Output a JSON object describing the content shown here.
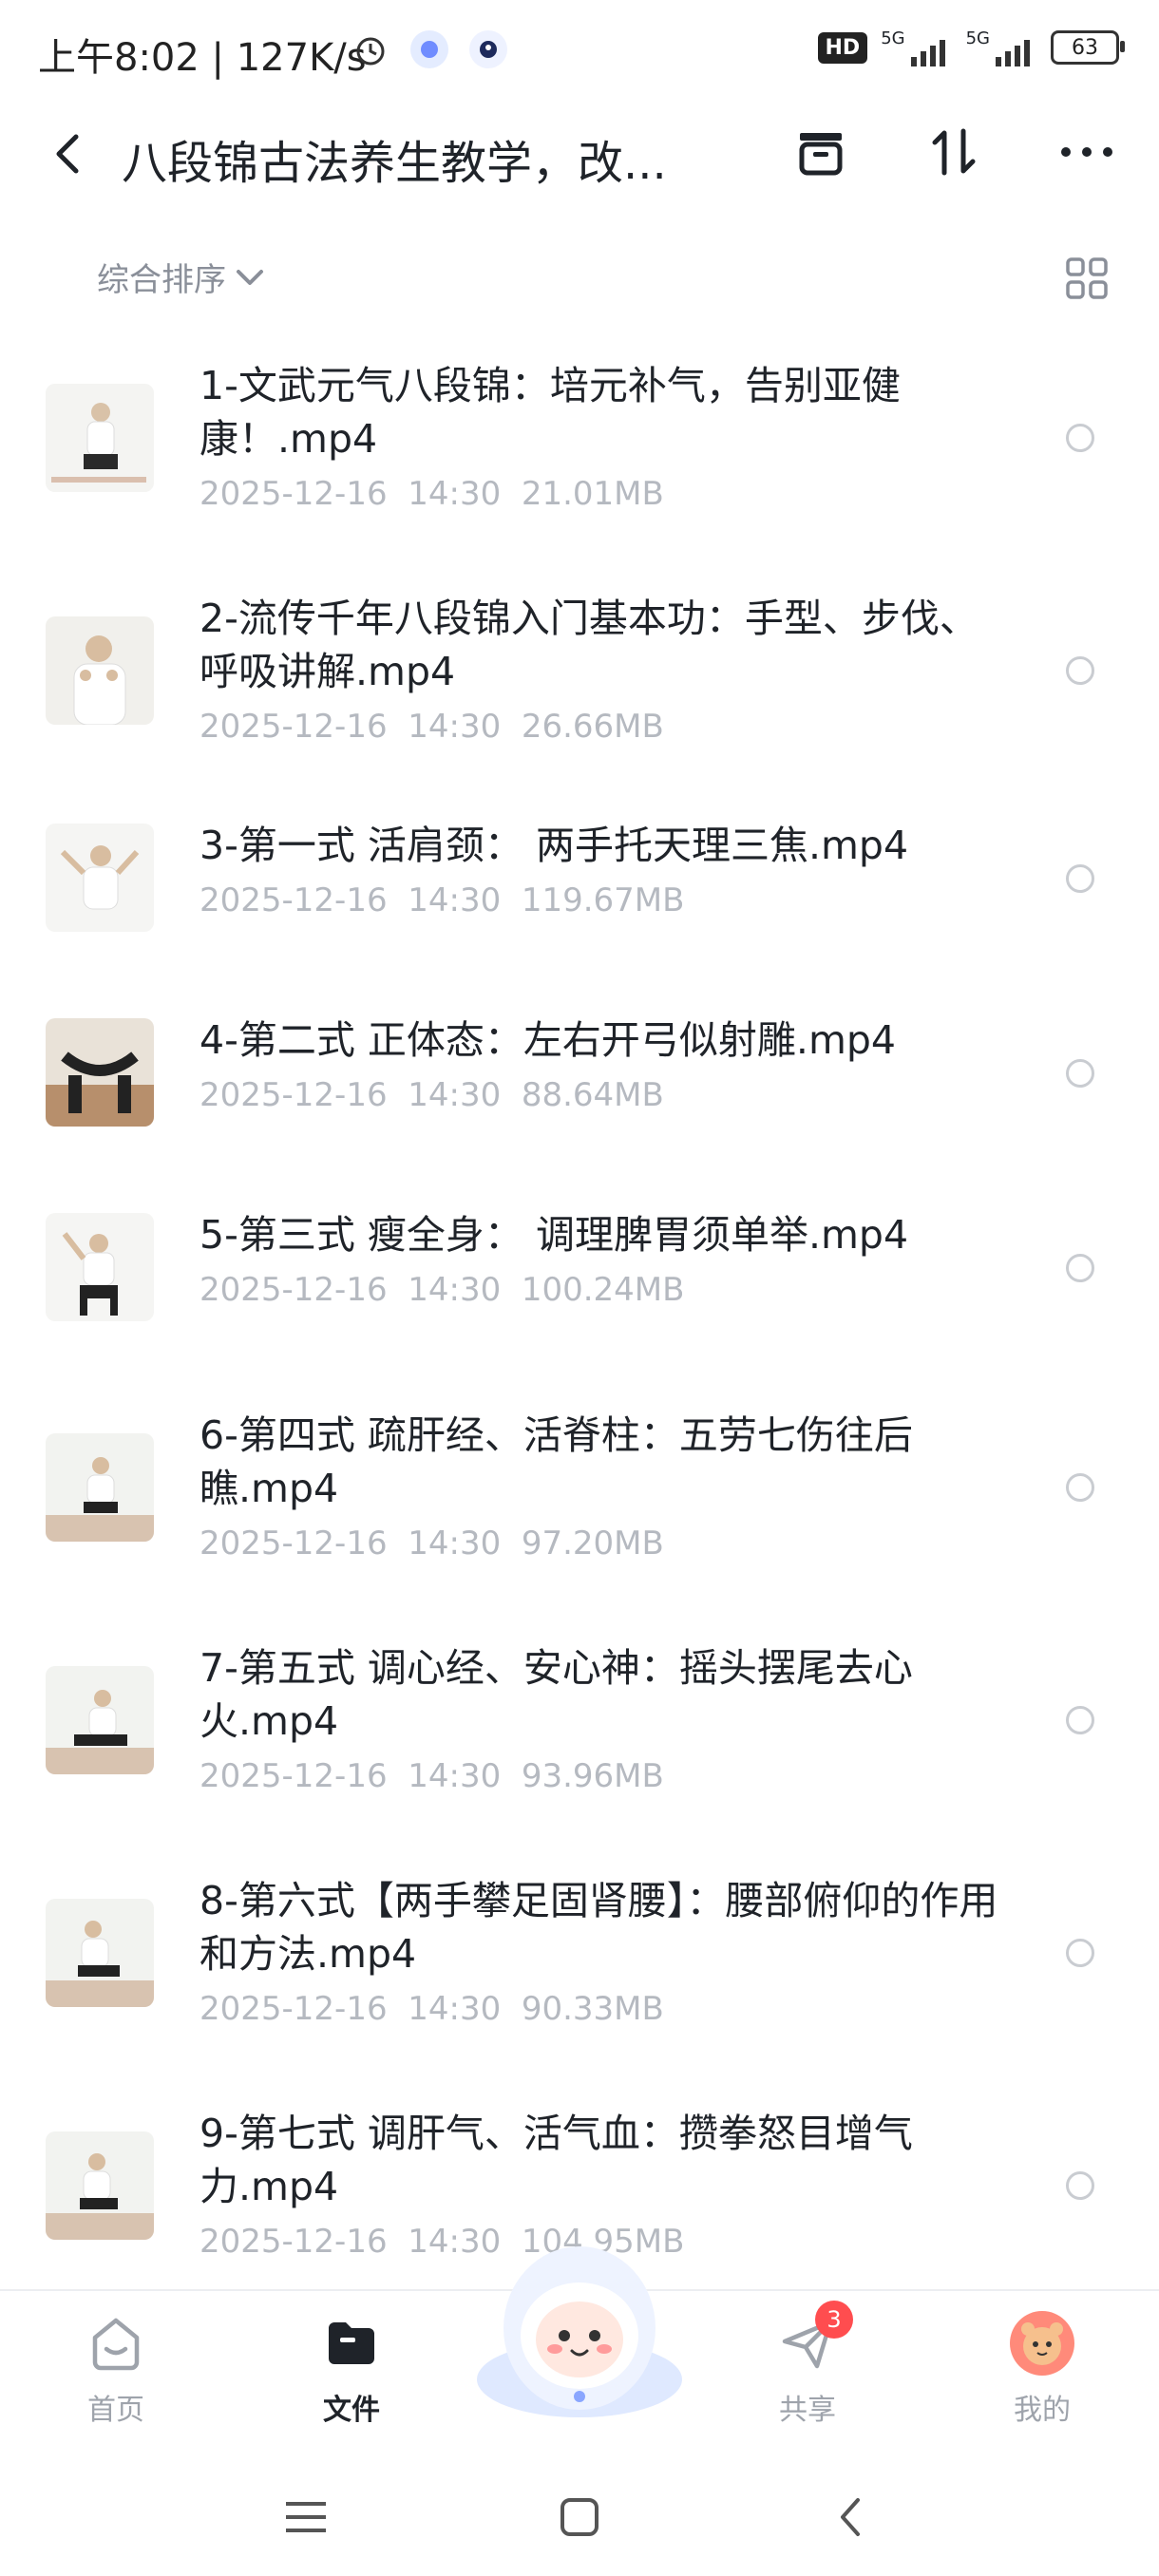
{
  "status_bar": {
    "time": "上午8:02 | 127K/s",
    "hd_label": "HD",
    "network1": "5G",
    "network2": "5G",
    "battery": "63"
  },
  "header": {
    "title": "八段锦古法养生教学，改..."
  },
  "sort": {
    "label": "综合排序"
  },
  "files": [
    {
      "name": "1-文武元气八段锦：培元补气，告别亚健康！.mp4",
      "date": "2025-12-16",
      "time": "14:30",
      "size": "21.01MB"
    },
    {
      "name": "2-流传千年八段锦入门基本功：手型、步伐、呼吸讲解.mp4",
      "date": "2025-12-16",
      "time": "14:30",
      "size": "26.66MB"
    },
    {
      "name": "3-第一式 活肩颈： 两手托天理三焦.mp4",
      "date": "2025-12-16",
      "time": "14:30",
      "size": "119.67MB"
    },
    {
      "name": "4-第二式 正体态：左右开弓似射雕.mp4",
      "date": "2025-12-16",
      "time": "14:30",
      "size": "88.64MB"
    },
    {
      "name": "5-第三式 瘦全身： 调理脾胃须单举.mp4",
      "date": "2025-12-16",
      "time": "14:30",
      "size": "100.24MB"
    },
    {
      "name": "6-第四式 疏肝经、活脊柱：五劳七伤往后瞧.mp4",
      "date": "2025-12-16",
      "time": "14:30",
      "size": "97.20MB"
    },
    {
      "name": "7-第五式 调心经、安心神：摇头摆尾去心火.mp4",
      "date": "2025-12-16",
      "time": "14:30",
      "size": "93.96MB"
    },
    {
      "name": "8-第六式【两手攀足固肾腰】：腰部俯仰的作用和方法.mp4",
      "date": "2025-12-16",
      "time": "14:30",
      "size": "90.33MB"
    },
    {
      "name": "9-第七式 调肝气、活气血：攒拳怒目增气力.mp4",
      "date": "2025-12-16",
      "time": "14:30",
      "size": "104.95MB"
    }
  ],
  "bottom_nav": {
    "home": "首页",
    "files": "文件",
    "share": "共享",
    "share_badge": "3",
    "mine": "我的"
  },
  "colors": {
    "accent": "#1f2329",
    "muted": "#9ea3ab",
    "badge": "#ff4d4f"
  }
}
